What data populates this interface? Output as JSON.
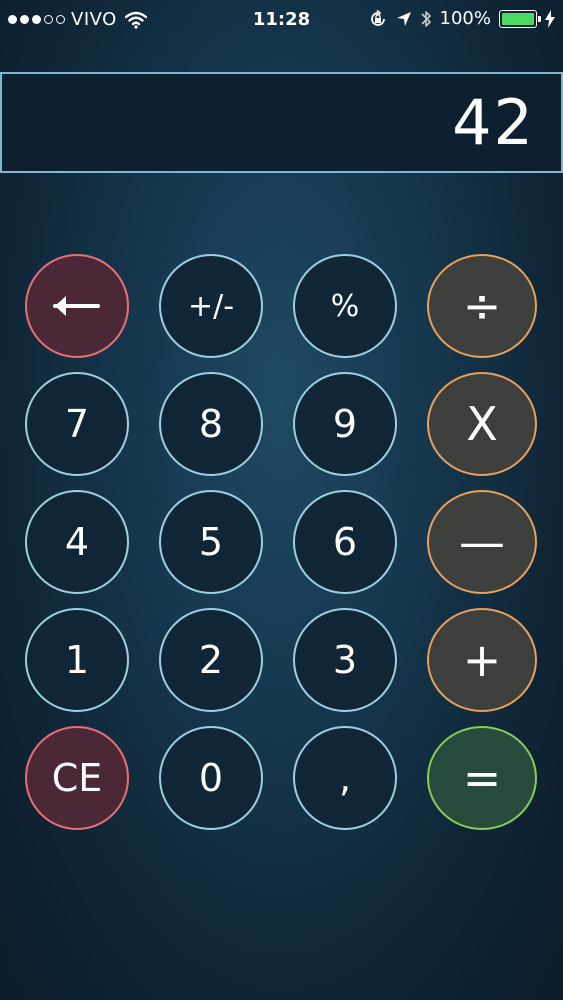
{
  "status_bar": {
    "carrier": "VIVO",
    "time": "11:28",
    "battery_percent": "100%",
    "signal_bars_filled": 3,
    "signal_bars_total": 5
  },
  "display": {
    "value": "42"
  },
  "keypad": {
    "backspace": "←",
    "plus_minus": "+/-",
    "percent": "%",
    "divide": "÷",
    "seven": "7",
    "eight": "8",
    "nine": "9",
    "multiply": "X",
    "four": "4",
    "five": "5",
    "six": "6",
    "minus": "—",
    "one": "1",
    "two": "2",
    "three": "3",
    "plus": "+",
    "clear": "CE",
    "zero": "0",
    "decimal": ",",
    "equals": "="
  },
  "colors": {
    "accent_red": "#e76f76",
    "accent_orange": "#e8a05a",
    "accent_green": "#89cc55",
    "number_border": "#9ccfe0",
    "battery_green": "#4cd964"
  },
  "icons": {
    "wifi": "wifi-icon",
    "lock_rotation": "orientation-lock-icon",
    "location": "location-arrow-icon",
    "bluetooth": "bluetooth-icon",
    "battery": "battery-icon",
    "charging": "charging-bolt-icon"
  }
}
